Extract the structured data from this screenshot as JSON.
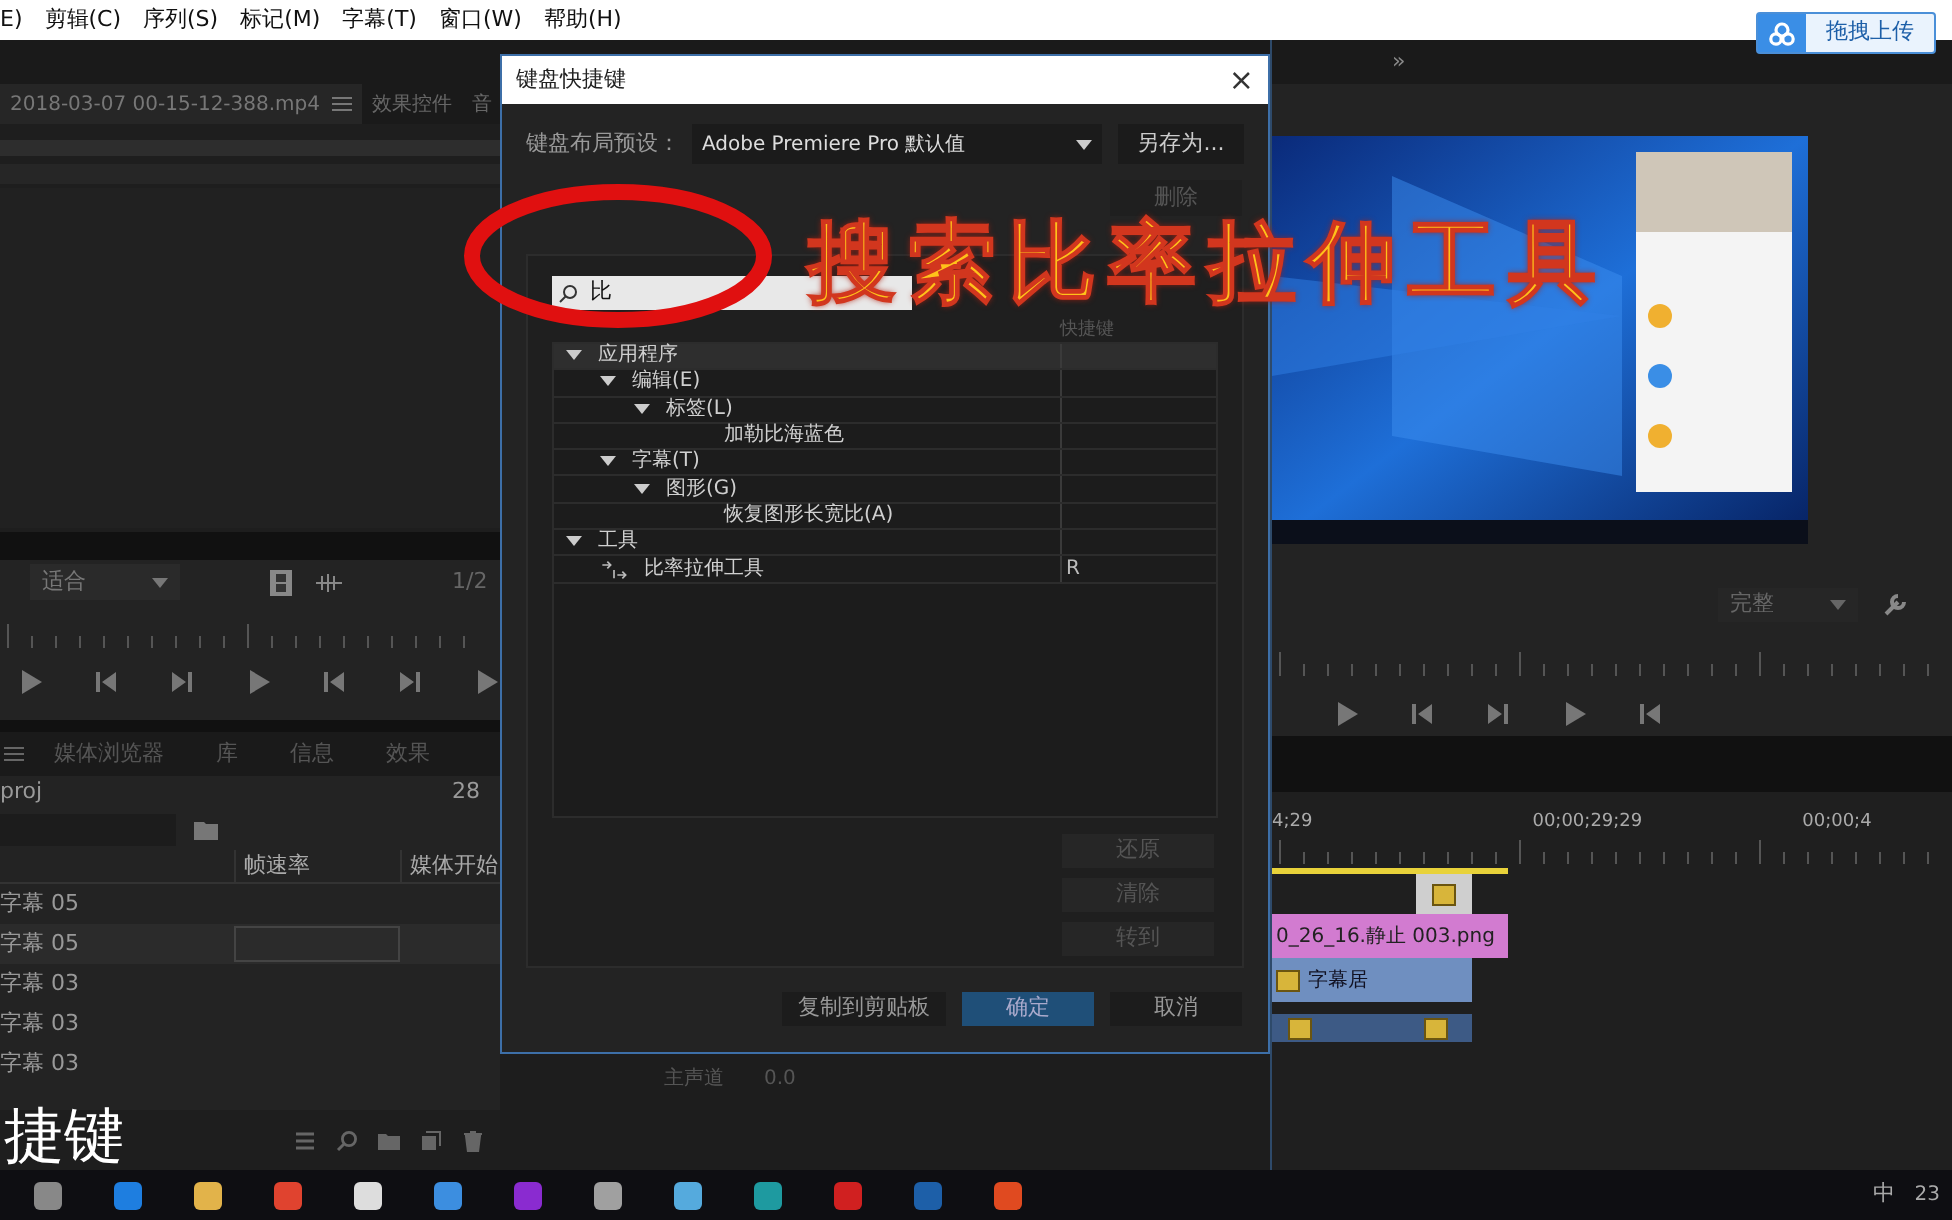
{
  "menu_bar": {
    "items": [
      "E)",
      "剪辑(C)",
      "序列(S)",
      "标记(M)",
      "字幕(T)",
      "窗口(W)",
      "帮助(H)"
    ],
    "upload_button": "拖拽上传"
  },
  "source_panel": {
    "tabs": [
      {
        "label": "2018-03-07 00-15-12-388.mp4",
        "selected": true
      },
      {
        "label": "效果控件",
        "selected": false
      },
      {
        "label": "音",
        "selected": false
      }
    ],
    "zoom": "适合",
    "page": "1/2"
  },
  "program_panel": {
    "more": "»",
    "quality": "完整"
  },
  "project_panel": {
    "tabs": [
      {
        "label": "媒体浏览器",
        "selected": false
      },
      {
        "label": "库",
        "selected": false
      },
      {
        "label": "信息",
        "selected": false
      },
      {
        "label": "效果",
        "selected": false
      }
    ],
    "name": "proj",
    "count": "28",
    "columns": [
      "帧速率",
      "媒体开始"
    ],
    "rows": [
      {
        "name": "字幕",
        "value": "05",
        "selected": false
      },
      {
        "name": "字幕",
        "value": "05",
        "selected": true
      },
      {
        "name": "字幕",
        "value": "03",
        "selected": false
      },
      {
        "name": "字幕",
        "value": "03",
        "selected": false
      },
      {
        "name": "字幕",
        "value": "03",
        "selected": false
      }
    ]
  },
  "audio_track": {
    "label": "主声道",
    "value": "0.0"
  },
  "timeline": {
    "times": [
      "4;29",
      "00;00;29;29",
      "00;00;4"
    ],
    "clips": [
      {
        "label": "0_26_16.静止 003.png"
      },
      {
        "label": "字幕居",
        "kind": "title"
      }
    ]
  },
  "dialog": {
    "title": "键盘快捷键",
    "close": "×",
    "preset_label": "键盘布局预设：",
    "preset_value": "Adobe Premiere Pro 默认值",
    "save_as": "另存为...",
    "delete": {
      "label": "删除",
      "disabled": true
    },
    "search": "比",
    "shortcut_column": "快捷键",
    "tree": [
      {
        "label": "应用程序",
        "kind": "group",
        "expanded": true,
        "children": [
          {
            "label": "编辑(E)",
            "kind": "group",
            "expanded": true,
            "children": [
              {
                "label": "标签(L)",
                "kind": "group",
                "expanded": true,
                "children": [
                  {
                    "label": "加勒比海蓝色",
                    "kind": "command"
                  }
                ]
              }
            ]
          },
          {
            "label": "字幕(T)",
            "kind": "group",
            "expanded": true,
            "children": [
              {
                "label": "图形(G)",
                "kind": "group",
                "expanded": true,
                "children": [
                  {
                    "label": "恢复图形长宽比(A)",
                    "kind": "command"
                  }
                ]
              }
            ]
          }
        ]
      },
      {
        "label": "工具",
        "kind": "group",
        "expanded": true,
        "children": [
          {
            "label": "比率拉伸工具",
            "kind": "tool",
            "shortcut": "R"
          }
        ]
      }
    ],
    "side_buttons": [
      {
        "label": "还原",
        "disabled": true
      },
      {
        "label": "清除",
        "disabled": true
      },
      {
        "label": "转到",
        "disabled": true
      }
    ],
    "footer_buttons": [
      {
        "label": "复制到剪贴板",
        "primary": false
      },
      {
        "label": "确定",
        "primary": true
      },
      {
        "label": "取消",
        "primary": false
      }
    ]
  },
  "caption": "搜索比率拉伸工具",
  "subtitle": "捷键",
  "taskbar": {
    "ime": "中",
    "clock": "23"
  }
}
